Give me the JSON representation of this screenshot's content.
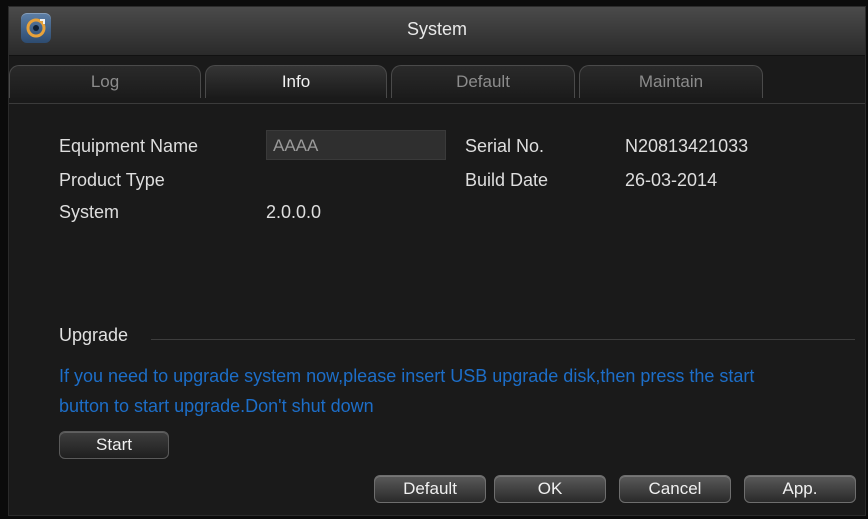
{
  "window": {
    "title": "System"
  },
  "tabs": [
    {
      "label": "Log",
      "active": false
    },
    {
      "label": "Info",
      "active": true
    },
    {
      "label": "Default",
      "active": false
    },
    {
      "label": "Maintain",
      "active": false
    }
  ],
  "info": {
    "equipment_name_label": "Equipment Name",
    "equipment_name_value": "AAAA",
    "product_type_label": "Product Type",
    "product_type_value": "",
    "system_label": "System",
    "system_value": "2.0.0.0",
    "serial_no_label": "Serial No.",
    "serial_no_value": "N20813421033",
    "build_date_label": "Build Date",
    "build_date_value": "26-03-2014"
  },
  "upgrade": {
    "title": "Upgrade",
    "message": "If you need to upgrade system now,please insert USB upgrade disk,then press the start button to start upgrade.Don't shut down",
    "start_label": "Start"
  },
  "footer": {
    "default_label": "Default",
    "ok_label": "OK",
    "cancel_label": "Cancel",
    "app_label": "App."
  },
  "colors": {
    "upgrade_text": "#1d6ec8",
    "window_bg": "#1a1a1a",
    "titlebar": "#3a3a3a"
  }
}
